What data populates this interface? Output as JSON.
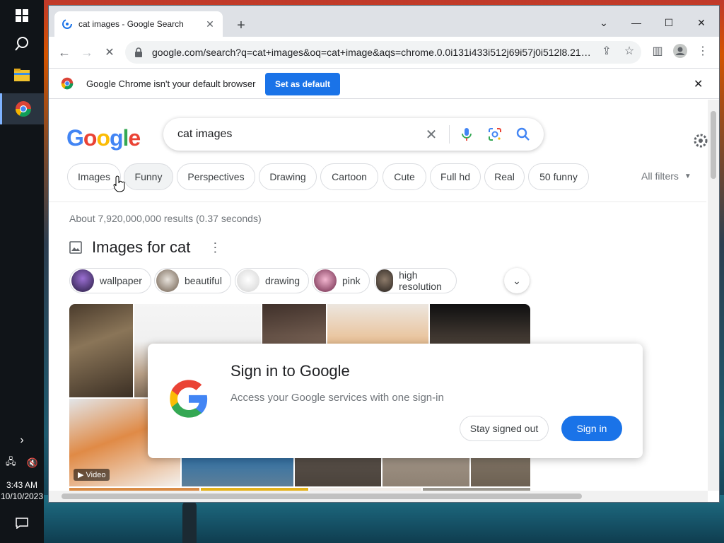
{
  "taskbar": {
    "clock_time": "3:43 AM",
    "clock_date": "10/10/2023",
    "items": [
      "start-icon",
      "search-icon",
      "file-explorer-icon",
      "chrome-icon"
    ]
  },
  "browser": {
    "tab_title": "cat images - Google Search",
    "url": "google.com/search?q=cat+images&oq=cat+image&aqs=chrome.0.0i131i433i512j69i57j0i512l8.213...",
    "infobar_message": "Google Chrome isn't your default browser",
    "set_default_label": "Set as default"
  },
  "search": {
    "logo": [
      "G",
      "o",
      "o",
      "g",
      "l",
      "e"
    ],
    "logo_colors": [
      "#4285F4",
      "#EA4335",
      "#FBBC05",
      "#4285F4",
      "#34A853",
      "#EA4335"
    ],
    "query": "cat images",
    "chips": [
      "Images",
      "Funny",
      "Perspectives",
      "Drawing",
      "Cartoon",
      "Cute",
      "Full hd",
      "Real",
      "50 funny"
    ],
    "all_filters": "All filters",
    "stats": "About 7,920,000,000 results (0.37 seconds)",
    "images_heading": "Images for cat",
    "refine_chips": [
      "wallpaper",
      "beautiful",
      "drawing",
      "pink",
      "high resolution"
    ],
    "video_label": "Video"
  },
  "signin_dialog": {
    "title": "Sign in to Google",
    "subtitle": "Access your Google services with one sign-in",
    "stay_label": "Stay signed out",
    "signin_label": "Sign in"
  },
  "colors": {
    "accent": "#1a73e8",
    "chrome_tabbar": "#dee1e6"
  }
}
